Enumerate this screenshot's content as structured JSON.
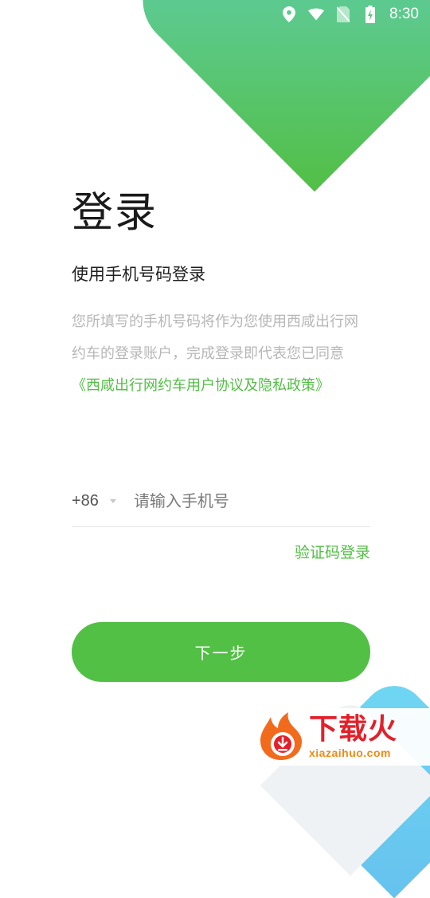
{
  "status_bar": {
    "time": "8:30",
    "icons": [
      "location-icon",
      "wifi-icon",
      "no-sim-icon",
      "battery-charging-icon"
    ]
  },
  "header": {
    "title": "登录",
    "subtitle": "使用手机号码登录"
  },
  "description": {
    "line1": "您所填写的手机号码将作为您使用西咸出行网",
    "line2": "约车的登录账户，完成登录即代表您已同意",
    "agreement_link": "《西咸出行网约车用户协议及隐私政策》"
  },
  "phone_form": {
    "country_code": "+86",
    "phone_placeholder": "请输入手机号",
    "phone_value": ""
  },
  "actions": {
    "code_login": "验证码登录",
    "next": "下一步"
  },
  "colors": {
    "brand_green": "#52bf45",
    "accent_blue": "#66c2ee"
  },
  "watermark": {
    "title": "下载火",
    "url": "xiazaihuo.com"
  }
}
